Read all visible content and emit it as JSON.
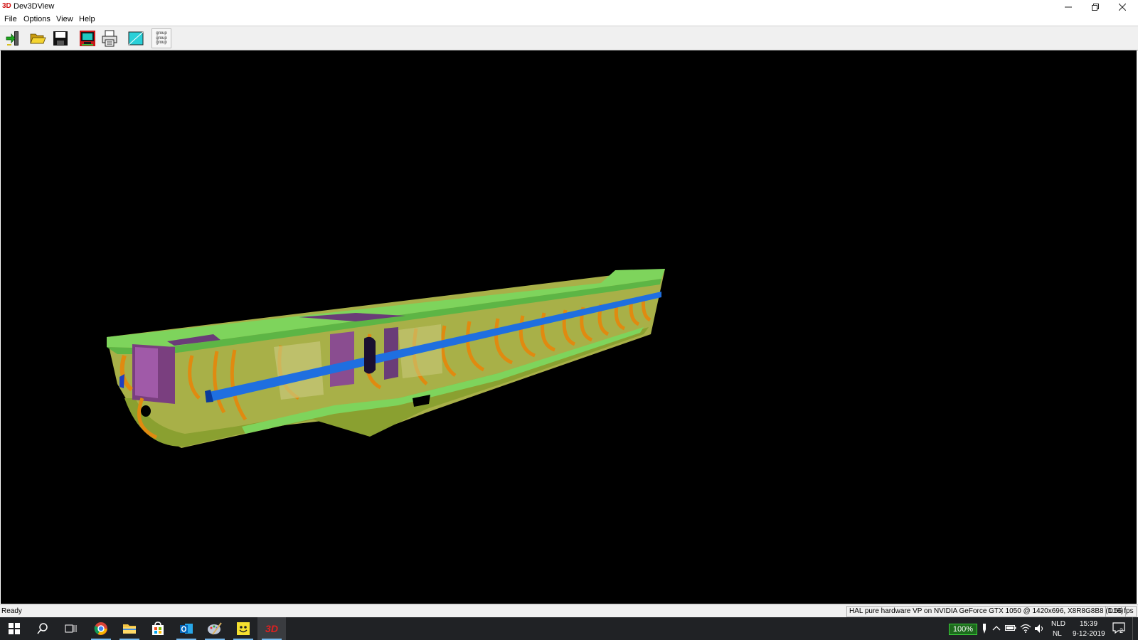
{
  "window": {
    "app_icon_text": "3D",
    "title": "Dev3DView"
  },
  "menu": {
    "items": [
      "File",
      "Options",
      "View",
      "Help"
    ]
  },
  "toolbar": {
    "buttons": [
      "exit-icon",
      "open-folder-icon",
      "save-disk-icon",
      "render-monitor-icon",
      "print-icon",
      "viewport-color-icon",
      "group-list-icon"
    ],
    "group_button_lines": [
      "group",
      "group",
      "group"
    ]
  },
  "viewport": {
    "background": "#000000",
    "model_colors": {
      "deck": "#7ed45c",
      "frames": "#b8b04a",
      "edges": "#e08a10",
      "stringer": "#1f6fe0",
      "bulkhead": "#7a3f7f"
    }
  },
  "status": {
    "left": "Ready",
    "renderer": "HAL pure hardware VP on NVIDIA GeForce GTX 1050 @ 1420x696, X8R8G8B8 (D16)",
    "fps": "1.56 fps"
  },
  "taskbar": {
    "apps": [
      "start-icon",
      "search-icon",
      "task-view-icon",
      "chrome-icon",
      "file-explorer-icon",
      "store-icon",
      "outlook-icon",
      "paint-icon",
      "smiley-app-icon",
      "dev3dview-icon"
    ],
    "dev3d_label": "3D",
    "battery": "100%",
    "lang_top": "NLD",
    "lang_bottom": "NL",
    "time": "15:39",
    "date": "9-12-2019",
    "notification_count": "2"
  }
}
